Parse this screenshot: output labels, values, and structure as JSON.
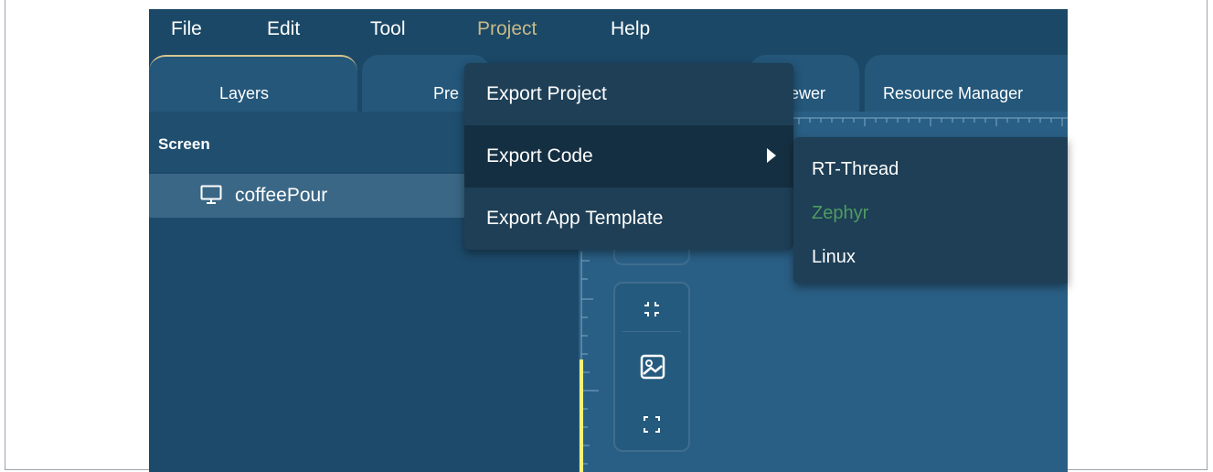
{
  "menubar": {
    "items": [
      {
        "label": "File"
      },
      {
        "label": "Edit"
      },
      {
        "label": "Tool"
      },
      {
        "label": "Project",
        "active": true
      },
      {
        "label": "Help"
      }
    ]
  },
  "tabs": [
    {
      "label": "Layers",
      "active": true
    },
    {
      "label": "Pre"
    },
    {
      "label": "iewer"
    },
    {
      "label": "Resource Manager"
    }
  ],
  "left_panel": {
    "header": "Screen",
    "tree_item": "coffeePour",
    "tree_item_icon": "monitor-icon"
  },
  "project_menu": {
    "items": [
      {
        "label": "Export Project"
      },
      {
        "label": "Export Code",
        "has_submenu": true,
        "hovered": true
      },
      {
        "label": "Export App Template"
      }
    ]
  },
  "export_code_submenu": {
    "items": [
      {
        "label": "RT-Thread"
      },
      {
        "label": "Zephyr",
        "disabled": true
      },
      {
        "label": "Linux"
      }
    ]
  },
  "toolbox": {
    "icons": [
      "shrink-icon",
      "image-icon",
      "expand-icon"
    ]
  },
  "colors": {
    "menubar_bg": "#1b4866",
    "menu_active": "#c7b98a",
    "dropdown_bg": "#1e3f56",
    "disabled_text": "#4e9b63",
    "ruler_highlight": "#f2f27a"
  }
}
